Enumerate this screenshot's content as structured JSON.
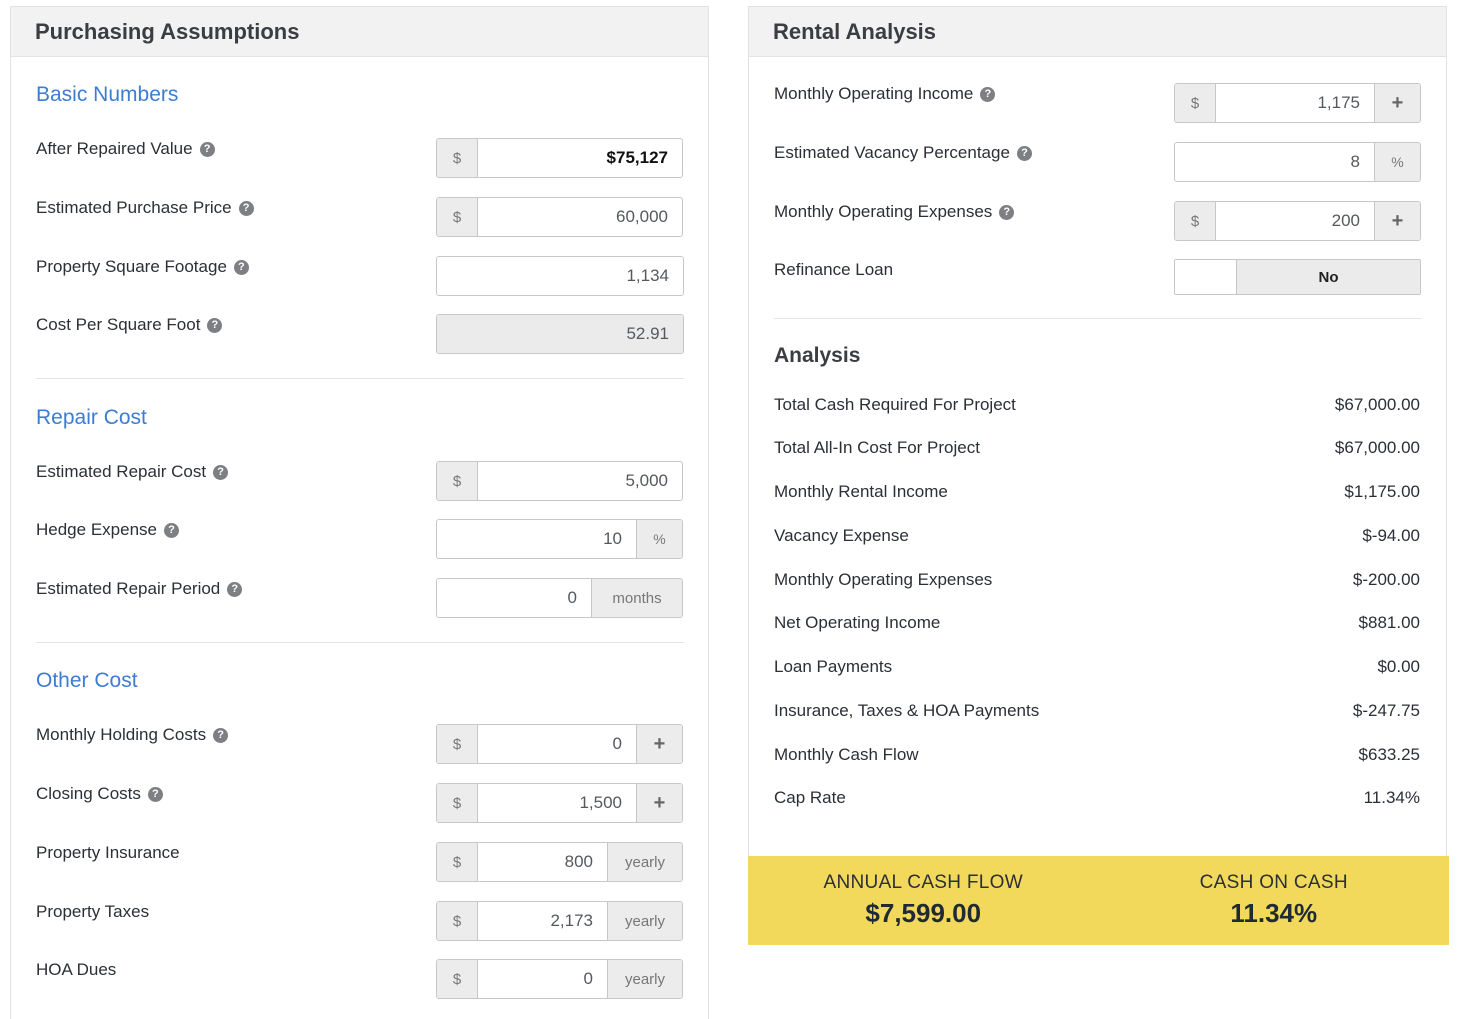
{
  "left": {
    "title": "Purchasing Assumptions",
    "sections": {
      "basic": "Basic Numbers",
      "repair": "Repair Cost",
      "other": "Other Cost"
    },
    "fields": {
      "arv": {
        "label": "After Repaired Value",
        "prefix": "$",
        "value": "$75,127"
      },
      "purchase_price": {
        "label": "Estimated Purchase Price",
        "prefix": "$",
        "value": "60,000"
      },
      "sqft": {
        "label": "Property Square Footage",
        "value": "1,134"
      },
      "cost_per_sqft": {
        "label": "Cost Per Square Foot",
        "value": "52.91"
      },
      "repair_cost": {
        "label": "Estimated Repair Cost",
        "prefix": "$",
        "value": "5,000"
      },
      "hedge": {
        "label": "Hedge Expense",
        "value": "10",
        "suffix": "%"
      },
      "repair_period": {
        "label": "Estimated Repair Period",
        "value": "0",
        "suffix": "months"
      },
      "holding": {
        "label": "Monthly Holding Costs",
        "prefix": "$",
        "value": "0",
        "suffix": "+"
      },
      "closing": {
        "label": "Closing Costs",
        "prefix": "$",
        "value": "1,500",
        "suffix": "+"
      },
      "insurance": {
        "label": "Property Insurance",
        "prefix": "$",
        "value": "800",
        "suffix": "yearly"
      },
      "taxes": {
        "label": "Property Taxes",
        "prefix": "$",
        "value": "2,173",
        "suffix": "yearly"
      },
      "hoa": {
        "label": "HOA Dues",
        "prefix": "$",
        "value": "0",
        "suffix": "yearly"
      }
    }
  },
  "right": {
    "title": "Rental Analysis",
    "fields": {
      "op_income": {
        "label": "Monthly Operating Income",
        "prefix": "$",
        "value": "1,175",
        "suffix": "+"
      },
      "vacancy": {
        "label": "Estimated Vacancy Percentage",
        "value": "8",
        "suffix": "%"
      },
      "op_expenses": {
        "label": "Monthly Operating Expenses",
        "prefix": "$",
        "value": "200",
        "suffix": "+"
      },
      "refinance": {
        "label": "Refinance Loan",
        "value": "No"
      }
    },
    "analysis_title": "Analysis",
    "analysis": [
      {
        "label": "Total Cash Required For Project",
        "value": "$67,000.00"
      },
      {
        "label": "Total All-In Cost For Project",
        "value": "$67,000.00"
      },
      {
        "label": "Monthly Rental Income",
        "value": "$1,175.00"
      },
      {
        "label": "Vacancy Expense",
        "value": "$-94.00"
      },
      {
        "label": "Monthly Operating Expenses",
        "value": "$-200.00"
      },
      {
        "label": "Net Operating Income",
        "value": "$881.00"
      },
      {
        "label": "Loan Payments",
        "value": "$0.00"
      },
      {
        "label": "Insurance, Taxes & HOA Payments",
        "value": "$-247.75"
      },
      {
        "label": "Monthly Cash Flow",
        "value": "$633.25"
      },
      {
        "label": "Cap Rate",
        "value": "11.34%"
      }
    ],
    "summary": {
      "annual_label": "ANNUAL CASH FLOW",
      "annual_value": "$7,599.00",
      "coc_label": "CASH ON CASH",
      "coc_value": "11.34%"
    }
  },
  "icons": {
    "help": "?"
  }
}
